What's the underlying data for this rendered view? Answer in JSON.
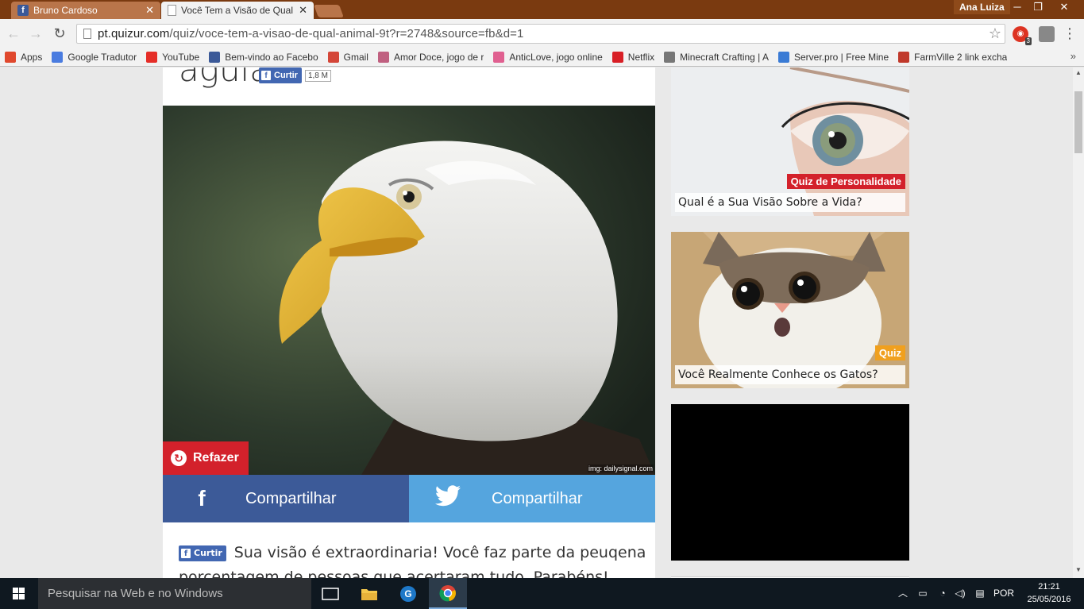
{
  "tabs": [
    {
      "title": "Bruno Cardoso",
      "icon": "facebook-icon",
      "active": false
    },
    {
      "title": "Você Tem a Visão de Qual",
      "icon": "page-icon",
      "active": true
    }
  ],
  "window": {
    "user": "Ana Luiza",
    "minimize": "─",
    "restore": "❐",
    "close": "✕"
  },
  "addressbar": {
    "url_host": "pt.quizur.com",
    "url_path": "/quiz/voce-tem-a-visao-de-qual-animal-9t?r=2748&source=fb&d=1",
    "adblock_count": "3"
  },
  "bookmarks": [
    {
      "label": "Apps",
      "icon": "apps-grid-icon",
      "color": "#e0482d"
    },
    {
      "label": "Google Tradutor",
      "icon": "google-translate-icon",
      "color": "#4a7ce0"
    },
    {
      "label": "YouTube",
      "icon": "youtube-icon",
      "color": "#e52d27"
    },
    {
      "label": "Bem-vindo ao Facebo",
      "icon": "facebook-icon",
      "color": "#3b5998"
    },
    {
      "label": "Gmail",
      "icon": "gmail-icon",
      "color": "#d44638"
    },
    {
      "label": "Amor Doce, jogo de r",
      "icon": "amor-doce-icon",
      "color": "#c06080"
    },
    {
      "label": "AnticLove, jogo online",
      "icon": "heart-icon",
      "color": "#e06090"
    },
    {
      "label": "Netflix",
      "icon": "netflix-icon",
      "color": "#d81f26"
    },
    {
      "label": "Minecraft Crafting | A",
      "icon": "minecraft-icon",
      "color": "#777777"
    },
    {
      "label": "Server.pro | Free Mine",
      "icon": "server-pro-icon",
      "color": "#3a7bd5"
    },
    {
      "label": "FarmVille 2 link excha",
      "icon": "farmville-icon",
      "color": "#c0392b"
    }
  ],
  "main": {
    "title": "águia",
    "like_label": "Curtir",
    "like_count": "1,8 M",
    "redo_label": "Refazer",
    "image_credit": "img: dailysignal.com",
    "share_facebook": "Compartilhar",
    "share_twitter": "Compartilhar",
    "result_text": "Sua visão é extraordinaria! Você faz parte da peuqena porcentagem de pessoas que acertaram tudo. Parabéns!"
  },
  "sidebar": {
    "card1": {
      "badge": "Quiz de Personalidade",
      "caption": "Qual é a Sua Visão Sobre a Vida?",
      "badge_color": "#d3212b"
    },
    "card2": {
      "badge": "Quiz",
      "caption": "Você Realmente Conhece os Gatos?",
      "badge_color": "#f0a01e"
    }
  },
  "taskbar": {
    "search_placeholder": "Pesquisar na Web e no Windows",
    "language": "POR",
    "time": "21:21",
    "date": "25/05/2016"
  }
}
